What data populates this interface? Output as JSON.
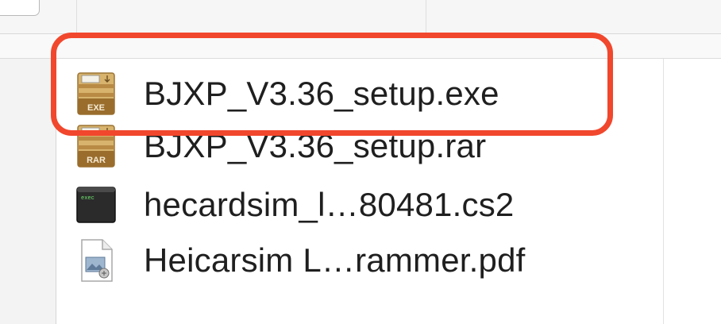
{
  "files": [
    {
      "name": "BJXP_V3.36_setup.exe",
      "icon": "exe-archive-icon",
      "badge": "EXE",
      "highlighted": true
    },
    {
      "name": "BJXP_V3.36_setup.rar",
      "icon": "rar-archive-icon",
      "badge": "RAR",
      "highlighted": false
    },
    {
      "name": "hecardsim_l…80481.cs2",
      "icon": "terminal-icon",
      "badge": "exec",
      "highlighted": false
    },
    {
      "name": "Heicarsim L…rammer.pdf",
      "icon": "pdf-preview-icon",
      "badge": "",
      "highlighted": false
    }
  ],
  "colors": {
    "highlight": "#f1472d",
    "archive_body": "#d7b36d",
    "archive_dark": "#a67c3a",
    "terminal": "#2b2b2b"
  }
}
